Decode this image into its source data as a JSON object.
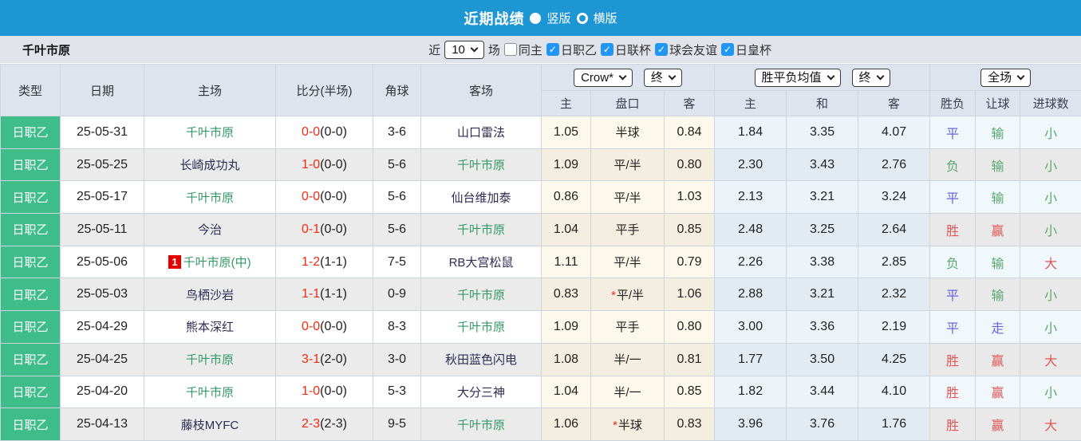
{
  "colors": {
    "topbar_blue": "#1f96d4",
    "checkbox_blue": "#2196f3",
    "league_green": "#3ebd8a",
    "team_green": "#339966",
    "team_navy": "#2c2c54",
    "score_red": "#f22b12",
    "result_red": "#e05555",
    "result_blue": "#6565dd",
    "result_green": "#5aa86e",
    "badge_red": "#e60000"
  },
  "topbar": {
    "title": "近期战绩",
    "portrait_label": "竖版",
    "landscape_label": "横版",
    "selected": "竖版"
  },
  "filter": {
    "team": "千叶市原",
    "near_label": "近",
    "count": "10",
    "games_label": "场",
    "same_home": {
      "label": "同主",
      "checked": false
    },
    "leagues": [
      {
        "label": "日职乙",
        "checked": true
      },
      {
        "label": "日联杯",
        "checked": true
      },
      {
        "label": "球会友谊",
        "checked": true
      },
      {
        "label": "日皇杯",
        "checked": true
      }
    ]
  },
  "table": {
    "header": {
      "left": [
        "类型",
        "日期",
        "主场",
        "比分(半场)",
        "角球",
        "客场"
      ],
      "dropdowns": {
        "crow": "Crow*",
        "crow_stage": "终",
        "avg": "胜平负均值",
        "avg_stage": "终",
        "scope": "全场"
      },
      "sub": [
        "主",
        "盘口",
        "客",
        "主",
        "和",
        "客",
        "胜负",
        "让球",
        "进球数"
      ]
    },
    "rows": [
      {
        "type": "日职乙",
        "date": "25-05-31",
        "home": {
          "name": "千叶市原",
          "focus": true,
          "badge": ""
        },
        "score": {
          "full": "0-0",
          "half": "(0-0)"
        },
        "corners": "3-6",
        "away": {
          "name": "山口雷法",
          "focus": false
        },
        "handicap": {
          "home": "1.05",
          "line": "半球",
          "star": false,
          "away": "0.84"
        },
        "avg": {
          "home": "1.84",
          "draw": "3.35",
          "away": "4.07"
        },
        "results": {
          "outcome": {
            "text": "平",
            "color": "blue"
          },
          "spread": {
            "text": "输",
            "color": "green"
          },
          "goals": {
            "text": "小",
            "color": "green"
          }
        }
      },
      {
        "type": "日职乙",
        "date": "25-05-25",
        "home": {
          "name": "长崎成功丸",
          "focus": false,
          "badge": ""
        },
        "score": {
          "full": "1-0",
          "half": "(0-0)"
        },
        "corners": "5-6",
        "away": {
          "name": "千叶市原",
          "focus": true
        },
        "handicap": {
          "home": "1.09",
          "line": "平/半",
          "star": false,
          "away": "0.80"
        },
        "avg": {
          "home": "2.30",
          "draw": "3.43",
          "away": "2.76"
        },
        "results": {
          "outcome": {
            "text": "负",
            "color": "green"
          },
          "spread": {
            "text": "输",
            "color": "green"
          },
          "goals": {
            "text": "小",
            "color": "green"
          }
        }
      },
      {
        "type": "日职乙",
        "date": "25-05-17",
        "home": {
          "name": "千叶市原",
          "focus": true,
          "badge": ""
        },
        "score": {
          "full": "0-0",
          "half": "(0-0)"
        },
        "corners": "5-6",
        "away": {
          "name": "仙台维加泰",
          "focus": false
        },
        "handicap": {
          "home": "0.86",
          "line": "平/半",
          "star": false,
          "away": "1.03"
        },
        "avg": {
          "home": "2.13",
          "draw": "3.21",
          "away": "3.24"
        },
        "results": {
          "outcome": {
            "text": "平",
            "color": "blue"
          },
          "spread": {
            "text": "输",
            "color": "green"
          },
          "goals": {
            "text": "小",
            "color": "green"
          }
        }
      },
      {
        "type": "日职乙",
        "date": "25-05-11",
        "home": {
          "name": "今治",
          "focus": false,
          "badge": ""
        },
        "score": {
          "full": "0-1",
          "half": "(0-0)"
        },
        "corners": "5-6",
        "away": {
          "name": "千叶市原",
          "focus": true
        },
        "handicap": {
          "home": "1.04",
          "line": "平手",
          "star": false,
          "away": "0.85"
        },
        "avg": {
          "home": "2.48",
          "draw": "3.25",
          "away": "2.64"
        },
        "results": {
          "outcome": {
            "text": "胜",
            "color": "red"
          },
          "spread": {
            "text": "赢",
            "color": "red"
          },
          "goals": {
            "text": "小",
            "color": "green"
          }
        }
      },
      {
        "type": "日职乙",
        "date": "25-05-06",
        "home": {
          "name": "千叶市原(中)",
          "focus": true,
          "badge": "1"
        },
        "score": {
          "full": "1-2",
          "half": "(1-1)"
        },
        "corners": "7-5",
        "away": {
          "name": "RB大宫松鼠",
          "focus": false
        },
        "handicap": {
          "home": "1.11",
          "line": "平/半",
          "star": false,
          "away": "0.79"
        },
        "avg": {
          "home": "2.26",
          "draw": "3.38",
          "away": "2.85"
        },
        "results": {
          "outcome": {
            "text": "负",
            "color": "green"
          },
          "spread": {
            "text": "输",
            "color": "green"
          },
          "goals": {
            "text": "大",
            "color": "red"
          }
        }
      },
      {
        "type": "日职乙",
        "date": "25-05-03",
        "home": {
          "name": "鸟栖沙岩",
          "focus": false,
          "badge": ""
        },
        "score": {
          "full": "1-1",
          "half": "(1-1)"
        },
        "corners": "0-9",
        "away": {
          "name": "千叶市原",
          "focus": true
        },
        "handicap": {
          "home": "0.83",
          "line": "平/半",
          "star": true,
          "away": "1.06"
        },
        "avg": {
          "home": "2.88",
          "draw": "3.21",
          "away": "2.32"
        },
        "results": {
          "outcome": {
            "text": "平",
            "color": "blue"
          },
          "spread": {
            "text": "输",
            "color": "green"
          },
          "goals": {
            "text": "小",
            "color": "green"
          }
        }
      },
      {
        "type": "日职乙",
        "date": "25-04-29",
        "home": {
          "name": "熊本深红",
          "focus": false,
          "badge": ""
        },
        "score": {
          "full": "0-0",
          "half": "(0-0)"
        },
        "corners": "8-3",
        "away": {
          "name": "千叶市原",
          "focus": true
        },
        "handicap": {
          "home": "1.09",
          "line": "平手",
          "star": false,
          "away": "0.80"
        },
        "avg": {
          "home": "3.00",
          "draw": "3.36",
          "away": "2.19"
        },
        "results": {
          "outcome": {
            "text": "平",
            "color": "blue"
          },
          "spread": {
            "text": "走",
            "color": "blue"
          },
          "goals": {
            "text": "小",
            "color": "green"
          }
        }
      },
      {
        "type": "日职乙",
        "date": "25-04-25",
        "home": {
          "name": "千叶市原",
          "focus": true,
          "badge": ""
        },
        "score": {
          "full": "3-1",
          "half": "(2-0)"
        },
        "corners": "3-0",
        "away": {
          "name": "秋田蓝色闪电",
          "focus": false
        },
        "handicap": {
          "home": "1.08",
          "line": "半/一",
          "star": false,
          "away": "0.81"
        },
        "avg": {
          "home": "1.77",
          "draw": "3.50",
          "away": "4.25"
        },
        "results": {
          "outcome": {
            "text": "胜",
            "color": "red"
          },
          "spread": {
            "text": "赢",
            "color": "red"
          },
          "goals": {
            "text": "大",
            "color": "red"
          }
        }
      },
      {
        "type": "日职乙",
        "date": "25-04-20",
        "home": {
          "name": "千叶市原",
          "focus": true,
          "badge": ""
        },
        "score": {
          "full": "1-0",
          "half": "(0-0)"
        },
        "corners": "5-3",
        "away": {
          "name": "大分三神",
          "focus": false
        },
        "handicap": {
          "home": "1.04",
          "line": "半/一",
          "star": false,
          "away": "0.85"
        },
        "avg": {
          "home": "1.82",
          "draw": "3.44",
          "away": "4.10"
        },
        "results": {
          "outcome": {
            "text": "胜",
            "color": "red"
          },
          "spread": {
            "text": "赢",
            "color": "red"
          },
          "goals": {
            "text": "小",
            "color": "green"
          }
        }
      },
      {
        "type": "日职乙",
        "date": "25-04-13",
        "home": {
          "name": "藤枝MYFC",
          "focus": false,
          "badge": ""
        },
        "score": {
          "full": "2-3",
          "half": "(2-3)"
        },
        "corners": "9-5",
        "away": {
          "name": "千叶市原",
          "focus": true
        },
        "handicap": {
          "home": "1.06",
          "line": "半球",
          "star": true,
          "away": "0.83"
        },
        "avg": {
          "home": "3.96",
          "draw": "3.76",
          "away": "1.76"
        },
        "results": {
          "outcome": {
            "text": "胜",
            "color": "red"
          },
          "spread": {
            "text": "赢",
            "color": "red"
          },
          "goals": {
            "text": "大",
            "color": "red"
          }
        }
      }
    ]
  }
}
